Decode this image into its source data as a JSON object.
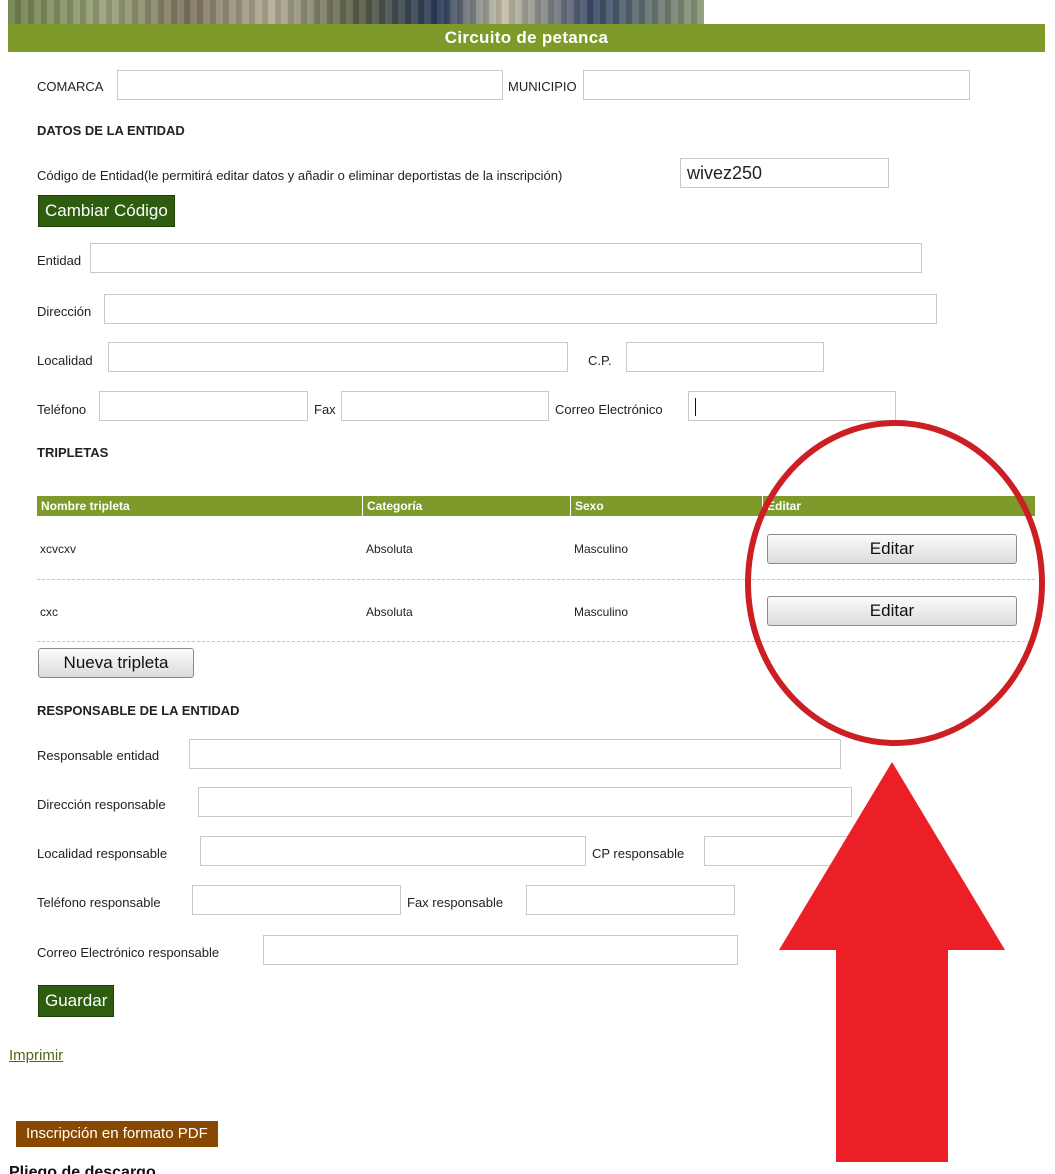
{
  "header": {
    "title": "Circuito de petanca"
  },
  "location": {
    "comarca_label": "COMARCA",
    "municipio_label": "MUNICIPIO"
  },
  "entity": {
    "section_title": "DATOS DE LA ENTIDAD",
    "code_label": "Código de Entidad(le permitirá editar datos y añadir o eliminar deportistas de la inscripción)",
    "code_value": "wivez250",
    "change_code_button": "Cambiar Código",
    "entidad_label": "Entidad",
    "direccion_label": "Dirección",
    "localidad_label": "Localidad",
    "cp_label": "C.P.",
    "telefono_label": "Teléfono",
    "fax_label": "Fax",
    "email_label": "Correo Electrónico"
  },
  "tripletas": {
    "section_title": "TRIPLETAS",
    "columns": [
      "Nombre tripleta",
      "Categoría",
      "Sexo",
      "Editar"
    ],
    "rows": [
      {
        "nombre": "xcvcxv",
        "categoria": "Absoluta",
        "sexo": "Masculino",
        "edit_label": "Editar"
      },
      {
        "nombre": "cxc",
        "categoria": "Absoluta",
        "sexo": "Masculino",
        "edit_label": "Editar"
      }
    ],
    "new_button": "Nueva tripleta"
  },
  "responsable": {
    "section_title": "RESPONSABLE DE LA ENTIDAD",
    "responsable_label": "Responsable entidad",
    "direccion_label": "Dirección responsable",
    "localidad_label": "Localidad responsable",
    "cp_label": "CP responsable",
    "telefono_label": "Teléfono responsable",
    "fax_label": "Fax responsable",
    "email_label": "Correo Electrónico responsable"
  },
  "actions": {
    "save_button": "Guardar",
    "print_link": "Imprimir",
    "pdf_button": "Inscripción en formato PDF",
    "pliego_link": "Pliego de descargo"
  },
  "annotation": {
    "circle_color": "#cc1f24",
    "arrow_color": "#ec1f26",
    "accent_green": "#7e9a2a",
    "dark_green": "#2f5d10",
    "pdf_brown": "#884800"
  }
}
